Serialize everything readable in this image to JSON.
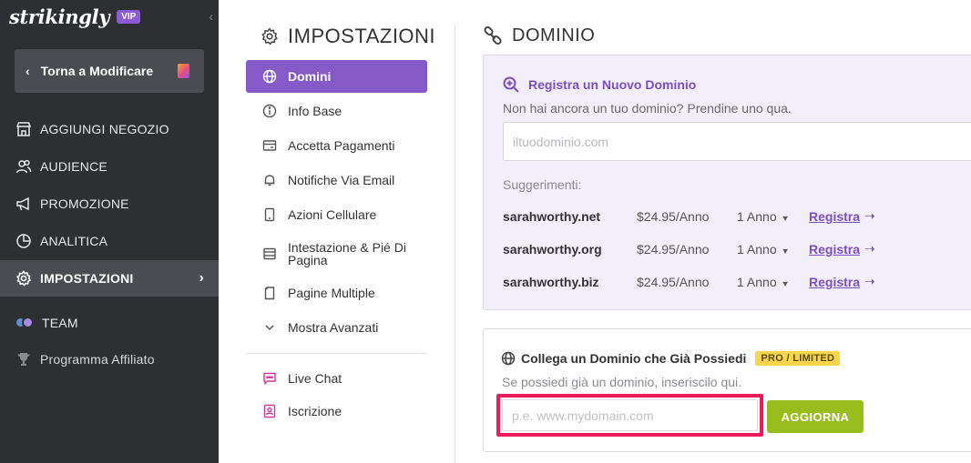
{
  "brand": {
    "logo_text": "strikingly",
    "vip_badge": "VIP"
  },
  "sidebar": {
    "back_button": "Torna a Modificare",
    "items": [
      {
        "label": "AGGIUNGI NEGOZIO",
        "icon": "store-icon"
      },
      {
        "label": "AUDIENCE",
        "icon": "users-icon"
      },
      {
        "label": "PROMOZIONE",
        "icon": "megaphone-icon"
      },
      {
        "label": "ANALITICA",
        "icon": "pie-chart-icon"
      },
      {
        "label": "IMPOSTAZIONI",
        "icon": "gear-icon",
        "active": true
      },
      {
        "label": "TEAM",
        "icon": "team-avatars-icon"
      },
      {
        "label": "Programma Affiliato",
        "icon": "trophy-icon"
      }
    ]
  },
  "settings": {
    "title": "IMPOSTAZIONI",
    "items": [
      {
        "label": "Domini",
        "icon": "globe-icon",
        "active": true
      },
      {
        "label": "Info Base",
        "icon": "info-icon"
      },
      {
        "label": "Accetta Pagamenti",
        "icon": "card-icon"
      },
      {
        "label": "Notifiche Via Email",
        "icon": "bell-icon"
      },
      {
        "label": "Azioni Cellulare",
        "icon": "mobile-icon"
      },
      {
        "label": "Intestazione & Pié Di Pagina",
        "icon": "layout-icon"
      },
      {
        "label": "Pagine Multiple",
        "icon": "pages-icon"
      },
      {
        "label": "Mostra Avanzati",
        "icon": "chevron-down-icon"
      },
      {
        "label": "Live Chat",
        "icon": "chat-icon"
      },
      {
        "label": "Iscrizione",
        "icon": "signup-icon"
      }
    ]
  },
  "main": {
    "title": "DOMINIO",
    "register": {
      "heading": "Registra un Nuovo Dominio",
      "subtitle": "Non hai ancora un tuo dominio? Prendine uno qua.",
      "placeholder": "iltuodominio.com",
      "suggestions_label": "Suggerimenti:",
      "suggestions": [
        {
          "domain": "sarahworthy.net",
          "price": "$24.95/Anno",
          "term": "1 Anno",
          "action": "Registra"
        },
        {
          "domain": "sarahworthy.org",
          "price": "$24.95/Anno",
          "term": "1 Anno",
          "action": "Registra"
        },
        {
          "domain": "sarahworthy.biz",
          "price": "$24.95/Anno",
          "term": "1 Anno",
          "action": "Registra"
        }
      ]
    },
    "connect": {
      "heading": "Collega un Dominio che Già Possiedi",
      "badge": "PRO / LIMITED",
      "subtitle": "Se possiedi già un dominio, inseriscilo qui.",
      "placeholder": "p.e. www.mydomain.com",
      "button": "AGGIORNA"
    }
  },
  "colors": {
    "sidebar_bg": "#2e2f33",
    "accent_purple": "#8559c8",
    "update_green": "#98be1e",
    "highlight_pink": "#ee1a5c",
    "badge_yellow": "#f8d54a"
  }
}
